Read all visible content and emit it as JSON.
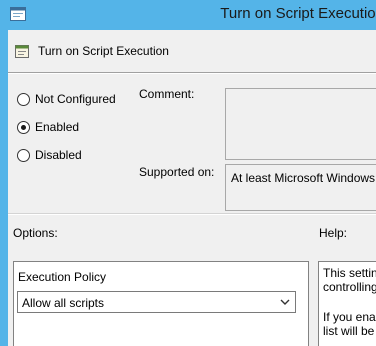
{
  "window": {
    "title": "Turn on Script Execution"
  },
  "header": {
    "title": "Turn on Script Execution",
    "icon": "policy-setting-icon"
  },
  "radios": [
    {
      "label": "Not Configured",
      "checked": false
    },
    {
      "label": "Enabled",
      "checked": true
    },
    {
      "label": "Disabled",
      "checked": false
    }
  ],
  "comment": {
    "label": "Comment:",
    "value": ""
  },
  "supported": {
    "label": "Supported on:",
    "value": "At least Microsoft Windows"
  },
  "options": {
    "label": "Options:",
    "execution_policy_label": "Execution Policy",
    "selected": "Allow all scripts"
  },
  "help": {
    "label": "Help:",
    "lines": [
      "This settin",
      "controlling",
      "If you ena",
      "list will be"
    ]
  },
  "colors": {
    "titlebar": "#54b4e8",
    "background": "#f0f0f0"
  }
}
